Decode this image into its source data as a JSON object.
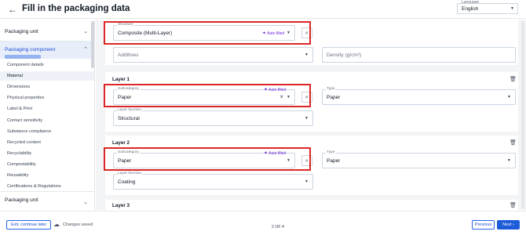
{
  "header": {
    "back_icon": "arrow-left-icon",
    "title": "Fill in the packaging data",
    "language_label": "Language",
    "language_value": "English"
  },
  "sidebar": {
    "group_packaging_unit": "Packaging unit",
    "group_packaging_component": "Packaging component",
    "items": [
      "Component details",
      "Material",
      "Dimensions",
      "Physical properties",
      "Label & Print",
      "Contact sensitivity",
      "Substance compliance",
      "Recycled content",
      "Recyclability",
      "Compostability",
      "Reusability",
      "Certifications & Regulations"
    ],
    "active_item": "Material",
    "group_packaging_unit_2": "Packaging unit"
  },
  "main": {
    "structure": {
      "label": "Structure",
      "value": "Composite (Multi-Layer)",
      "auto_filled": "Auto filled"
    },
    "additives": {
      "placeholder": "Additives"
    },
    "density": {
      "placeholder": "Density (g/cm³)"
    },
    "layers": [
      {
        "title": "Layer 1",
        "subcategory_label": "Subcategory",
        "subcategory_value": "Paper",
        "auto_filled": "Auto filled",
        "type_label": "Type",
        "type_value": "Paper",
        "function_label": "Layer function",
        "function_value": "Structural"
      },
      {
        "title": "Layer 2",
        "subcategory_label": "Subcategory",
        "subcategory_value": "Paper",
        "auto_filled": "Auto filled",
        "type_label": "Type",
        "type_value": "Paper",
        "function_label": "Layer function",
        "function_value": "Coating"
      },
      {
        "title": "Layer 3"
      }
    ]
  },
  "footer": {
    "exit_label": "Exit, continue later",
    "saved_label": "Changes saved",
    "pager": "2 OF 4",
    "previous_label": "Previous",
    "next_label": "Next"
  },
  "colors": {
    "accent": "#1d5bd8",
    "highlight": "#dc2626",
    "auto_filled": "#6d28d9"
  }
}
